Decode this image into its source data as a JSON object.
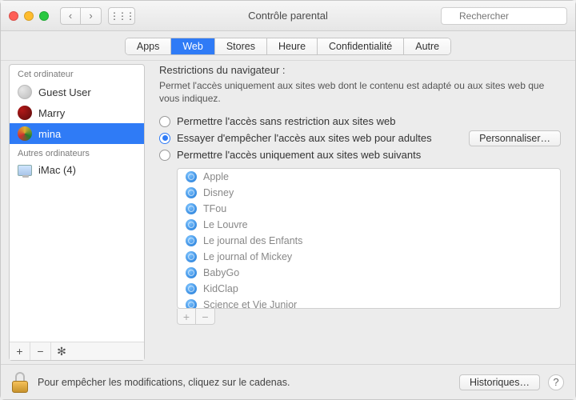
{
  "window": {
    "title": "Contrôle parental",
    "search_placeholder": "Rechercher"
  },
  "tabs": {
    "items": [
      "Apps",
      "Web",
      "Stores",
      "Heure",
      "Confidentialité",
      "Autre"
    ],
    "active_index": 1
  },
  "sidebar": {
    "section_this": "Cet ordinateur",
    "section_others": "Autres ordinateurs",
    "users": [
      {
        "name": "Guest User",
        "avatar": "grey",
        "selected": false
      },
      {
        "name": "Marry",
        "avatar": "red",
        "selected": false
      },
      {
        "name": "mina",
        "avatar": "mix",
        "selected": true
      }
    ],
    "others": [
      {
        "name": "iMac (4)"
      }
    ]
  },
  "content": {
    "section_title": "Restrictions du navigateur :",
    "section_desc": "Permet l'accès uniquement aux sites web dont le contenu est adapté ou aux sites web que vous indiquez.",
    "radios": {
      "opt0": "Permettre l'accès sans restriction aux sites web",
      "opt1": "Essayer d'empêcher l'accès aux sites web pour adultes",
      "opt2": "Permettre l'accès uniquement aux sites web suivants",
      "selected": 1
    },
    "customize_label": "Personnaliser…",
    "sites": [
      "Apple",
      "Disney",
      "TFou",
      "Le Louvre",
      "Le journal des Enfants",
      "Le journal of Mickey",
      "BabyGo",
      "KidClap",
      "Science et Vie Junior"
    ]
  },
  "bottom": {
    "lock_text": "Pour empêcher les modifications, cliquez sur le cadenas.",
    "history_label": "Historiques…"
  }
}
